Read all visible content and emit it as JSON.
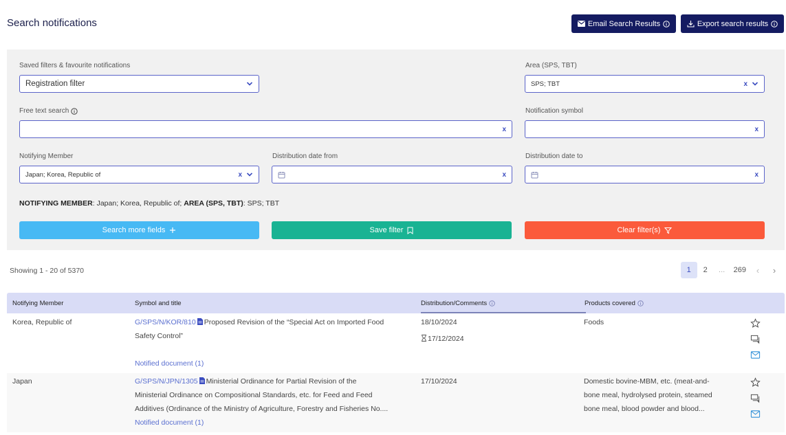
{
  "page": {
    "title": "Search notifications"
  },
  "toolbar": {
    "email_label": "Email Search Results",
    "export_label": "Export search results"
  },
  "filters": {
    "saved": {
      "label": "Saved filters & favourite notifications",
      "value": "Registration filter"
    },
    "area": {
      "label": "Area (SPS, TBT)",
      "value": "SPS; TBT"
    },
    "free_text": {
      "label": "Free text search",
      "value": ""
    },
    "symbol": {
      "label": "Notification symbol",
      "value": ""
    },
    "member": {
      "label": "Notifying Member",
      "value": "Japan; Korea, Republic of"
    },
    "date_from": {
      "label": "Distribution date from",
      "value": ""
    },
    "date_to": {
      "label": "Distribution date to",
      "value": ""
    }
  },
  "summary": {
    "member_key": "NOTIFYING MEMBER",
    "member_val": ": Japan; Korea, Republic of;",
    "area_key": "AREA (SPS, TBT)",
    "area_val": ": SPS; TBT"
  },
  "actions": {
    "more": "Search more fields",
    "save": "Save filter",
    "clear": "Clear filter(s)"
  },
  "results": {
    "showing": "Showing 1 - 20 of 5370",
    "pagination": [
      "1",
      "2",
      "...",
      "269"
    ]
  },
  "table": {
    "headers": [
      "Notifying Member",
      "Symbol and title",
      "Distribution/Comments",
      "Products covered"
    ],
    "rows": [
      {
        "member": "Korea, Republic of",
        "symbol": "G/SPS/N/KOR/810",
        "title_l1": "Proposed Revision of the “Special Act on Imported Food",
        "title_l2": "Safety Control”",
        "doc": "Notified document (1)",
        "date": "18/10/2024",
        "comments": "17/12/2024",
        "products_l1": "Foods",
        "products_l2": "",
        "products_l3": ""
      },
      {
        "member": "Japan",
        "symbol": "G/SPS/N/JPN/1305",
        "title_l1": "Ministerial Ordinance for Partial Revision of the",
        "title_l2": "Ministerial Ordinance on Compositional Standards, etc. for Feed and Feed",
        "title_l3": "Additives (Ordinance of the Ministry of Agriculture, Forestry and Fisheries No....",
        "doc": "Notified document (1)",
        "date": "17/10/2024",
        "products_l1": "Domestic bovine-MBM, etc. (meat-and-",
        "products_l2": "bone meal, hydrolysed protein, steamed",
        "products_l3": "bone meal, blood powder and blood..."
      }
    ]
  },
  "colors": {
    "primary": "#141b61",
    "more": "#47b9f4",
    "save": "#19b393",
    "clear": "#fb5a3b",
    "link": "#5a6fd0"
  }
}
